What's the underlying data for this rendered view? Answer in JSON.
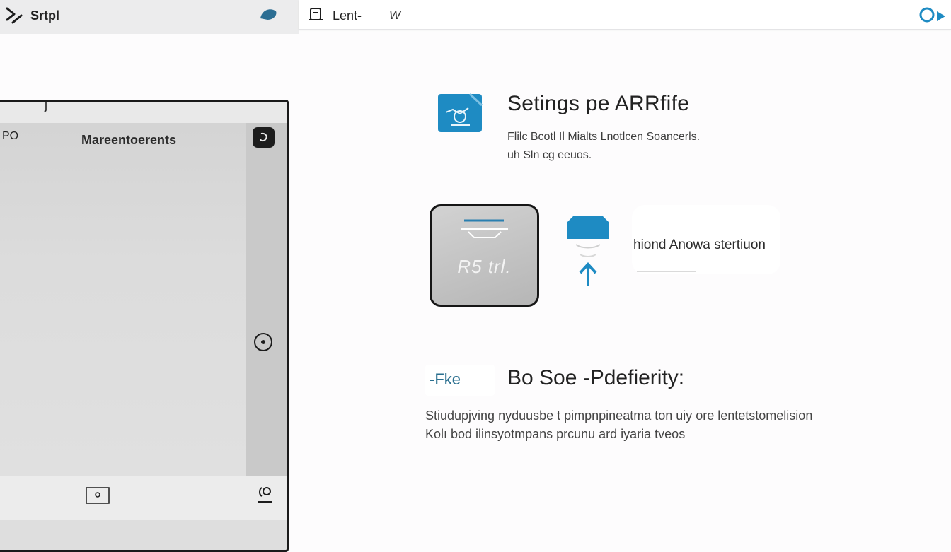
{
  "topbar_left": {
    "title": "Srtpl"
  },
  "topbar_right": {
    "tab_label": "Lent-",
    "tab_extra": "W"
  },
  "panel": {
    "strip_mark": "j",
    "tag": "PO",
    "title": "Mareentoerents"
  },
  "settings": {
    "title": "Setings pe ARRfife",
    "description_line1": "Flilc Bcotl Il Mialts Lnotlcen Soancerls.",
    "description_line2": "uh Sln cg eeuos."
  },
  "card": {
    "label": "R5 trl."
  },
  "option": {
    "label": "hiond Anowa stertiuon"
  },
  "badge": {
    "label": "-Fke"
  },
  "section": {
    "title": "Bo Soe -Pdefierity:",
    "description_line1": "Stiudupjving nyduusbe t pimpnpineatma ton uiy ore lentetstomelision",
    "description_line2": "Kolı bod ilinsyotmpans prcunu ard iyaria tveos"
  },
  "colors": {
    "accent_blue": "#1e8bc3",
    "panel_border": "#1a1a1a",
    "topbar_left_bg": "#ececed"
  },
  "icons": {
    "chevron": "chevron-icon",
    "leaf": "leaf-icon",
    "doc": "doc-icon",
    "share": "share-icon",
    "settings": "settings-icon",
    "upload": "upload-icon",
    "eye": "eye-icon",
    "frame": "frame-icon",
    "user": "user-icon"
  }
}
